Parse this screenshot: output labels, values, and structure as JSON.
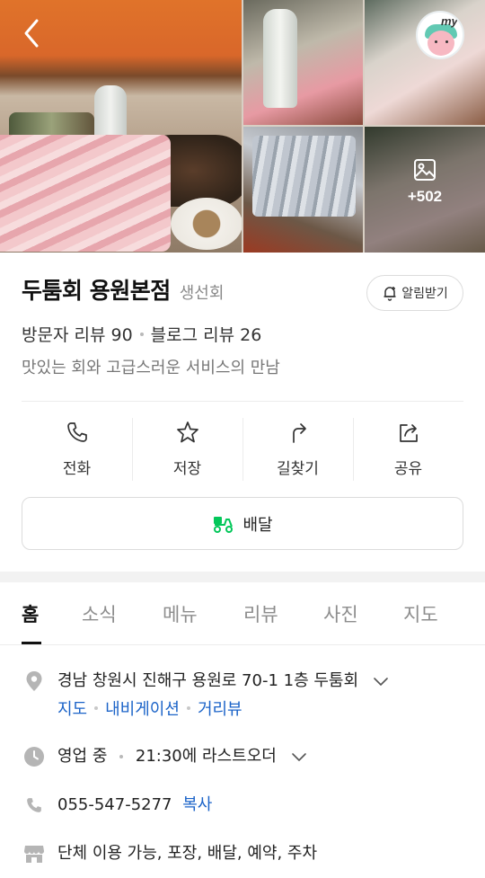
{
  "photos": {
    "more_count": "+502"
  },
  "avatar": {
    "label": "my"
  },
  "place": {
    "name": "두툼회 용원본점",
    "category": "생선회",
    "alarm_label": "알림받기",
    "visitor_reviews": "방문자 리뷰 90",
    "blog_reviews": "블로그 리뷰 26",
    "description": "맛있는 회와 고급스러운 서비스의 만남"
  },
  "actions": [
    {
      "label": "전화",
      "icon": "phone-icon"
    },
    {
      "label": "저장",
      "icon": "star-icon"
    },
    {
      "label": "길찾기",
      "icon": "directions-icon"
    },
    {
      "label": "공유",
      "icon": "share-icon"
    }
  ],
  "delivery": {
    "label": "배달",
    "color": "#03c75a"
  },
  "tabs": [
    "홈",
    "소식",
    "메뉴",
    "리뷰",
    "사진",
    "지도"
  ],
  "active_tab": "홈",
  "details": {
    "address": "경남 창원시 진해구 용원로 70-1 1층 두툼회",
    "address_links": [
      "지도",
      "내비게이션",
      "거리뷰"
    ],
    "hours_status": "영업 중",
    "hours_detail": "21:30에 라스트오더",
    "phone": "055-547-5277",
    "phone_copy": "복사",
    "amenities": "단체 이용 가능, 포장, 배달, 예약, 주차"
  },
  "colors": {
    "link": "#1b63c8",
    "accent_green": "#03c75a"
  }
}
